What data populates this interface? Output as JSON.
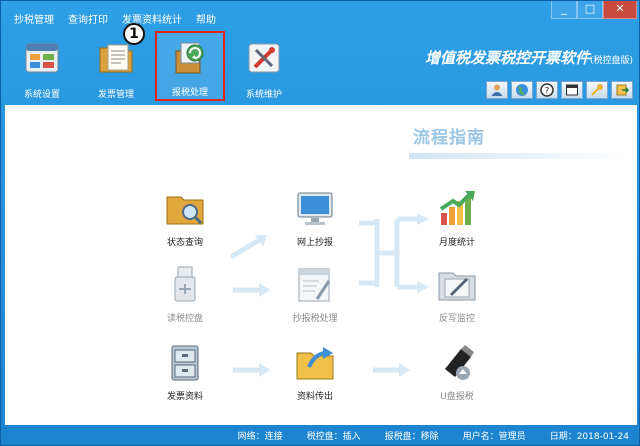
{
  "menu": [
    "抄税管理",
    "查询打印",
    "发票资料统计",
    "帮助"
  ],
  "window_controls": [
    "_",
    "□",
    "✕"
  ],
  "toolbar": [
    {
      "label": "系统设置",
      "icon": "settings-window-icon"
    },
    {
      "label": "发票管理",
      "icon": "invoice-folder-icon"
    },
    {
      "label": "报税处理",
      "icon": "tax-report-icon",
      "active": true
    },
    {
      "label": "系统维护",
      "icon": "maintenance-tools-icon"
    }
  ],
  "step_badge": "1",
  "brand": {
    "title": "增值税发票税控开票软件",
    "subtitle": "(税控盘版)"
  },
  "guide": {
    "title": "流程指南"
  },
  "flow": {
    "status_query": "状态查询",
    "online_copy": "网上抄报",
    "monthly_stats": "月度统计",
    "read_disk": "读税控盘",
    "copy_report": "抄报税处理",
    "writeback": "反写监控",
    "invoice_data": "发票资料",
    "data_export": "资料传出",
    "usb_report": "U盘报税"
  },
  "status": {
    "network": "网络：连接",
    "tax_disk": "税控盘：插入",
    "report_disk": "报税盘：移除",
    "user": "用户名：管理员",
    "date": "日期：2018-01-24"
  },
  "colors": {
    "accent": "#1f8fd6",
    "highlight_border": "#e1251b",
    "guide_text": "#9cc6e4",
    "arrow": "#d6e8f5"
  }
}
